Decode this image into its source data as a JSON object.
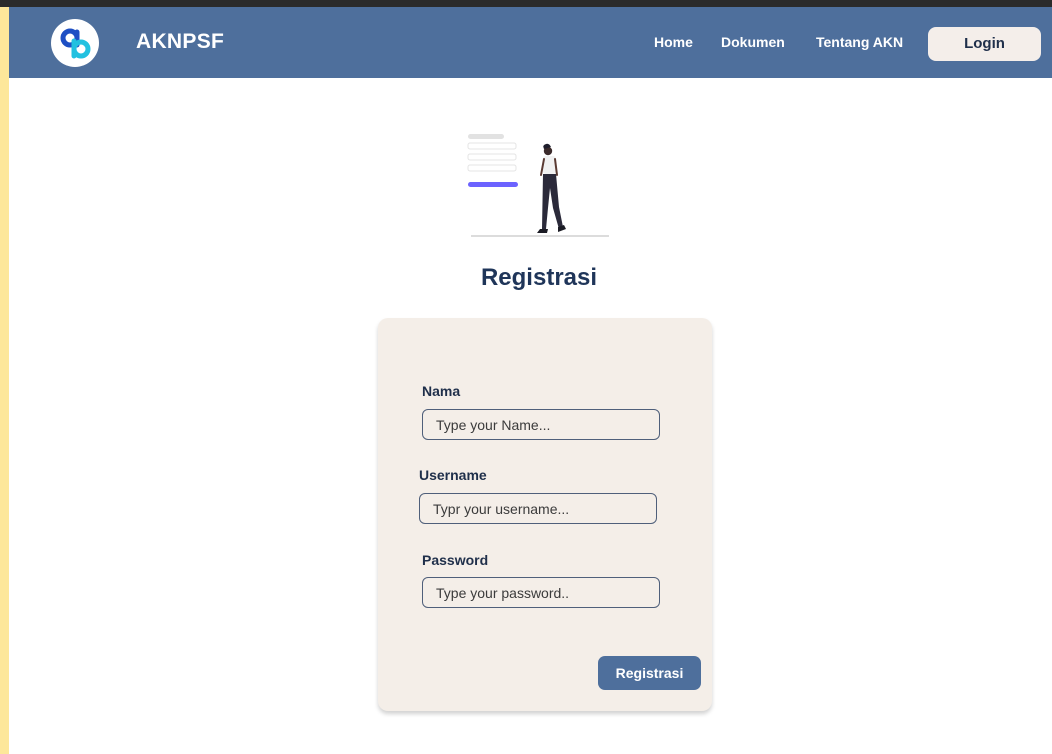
{
  "nav": {
    "brand": "AKNPSF",
    "links": [
      "Home",
      "Dokumen",
      "Tentang AKN"
    ],
    "login_label": "Login"
  },
  "page": {
    "title": "Registrasi"
  },
  "form": {
    "fields": [
      {
        "label": "Nama",
        "placeholder": "Type your Name...",
        "value": ""
      },
      {
        "label": "Username",
        "placeholder": "Typr your username...",
        "value": ""
      },
      {
        "label": "Password",
        "placeholder": "Type your password..",
        "value": ""
      }
    ],
    "submit_label": "Registrasi"
  },
  "colors": {
    "navbar": "#4e6f9c",
    "outer_background": "#fde79a",
    "card": "#f4eee8",
    "title": "#1f3559",
    "illustration_accent": "#6c63ff"
  },
  "icons": {
    "logo": "qb-logo-icon",
    "illustration": "person-walking-from-form-illustration"
  }
}
